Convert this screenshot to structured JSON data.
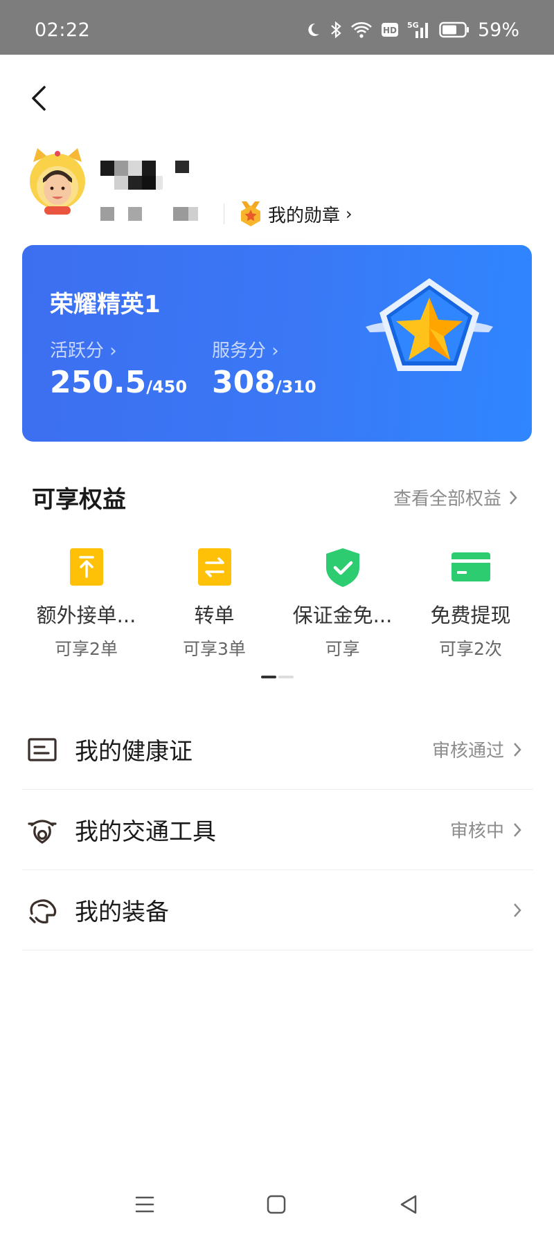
{
  "status_bar": {
    "time": "02:22",
    "battery": "59%",
    "icons": [
      "moon-icon",
      "bluetooth-icon",
      "wifi-icon",
      "hd-icon",
      "5g-signal-icon",
      "battery-icon"
    ]
  },
  "header": {
    "back_icon": "back-arrow-icon",
    "medal_label": "我的勋章",
    "medal_chevron": "›"
  },
  "level_card": {
    "title": "荣耀精英1",
    "active": {
      "label": "活跃分 ›",
      "value": "250.5",
      "max": "/450"
    },
    "service": {
      "label": "服务分 ›",
      "value": "308",
      "max": "/310"
    },
    "colors": {
      "card_start": "#3c6ff0",
      "card_end": "#2f86ff",
      "badge_border": "#1565e0",
      "star": "#ffc21a"
    }
  },
  "benefits": {
    "title": "可享权益",
    "view_all": "查看全部权益",
    "items": [
      {
        "name": "额外接单...",
        "sub": "可享2单",
        "icon": "upload-arrow-icon",
        "color": "#ffc107"
      },
      {
        "name": "转单",
        "sub": "可享3单",
        "icon": "swap-arrows-icon",
        "color": "#ffc107"
      },
      {
        "name": "保证金免...",
        "sub": "可享",
        "icon": "shield-check-icon",
        "color": "#2ecc71"
      },
      {
        "name": "免费提现",
        "sub": "可享2次",
        "icon": "card-icon",
        "color": "#2ecc71"
      }
    ]
  },
  "list": [
    {
      "label": "我的健康证",
      "status": "审核通过",
      "icon": "health-card-icon"
    },
    {
      "label": "我的交通工具",
      "status": "审核中",
      "icon": "vehicle-icon"
    },
    {
      "label": "我的装备",
      "status": "",
      "icon": "equipment-icon"
    }
  ],
  "nav_bar": {
    "icons": [
      "menu-icon",
      "home-square-icon",
      "back-triangle-icon"
    ]
  }
}
